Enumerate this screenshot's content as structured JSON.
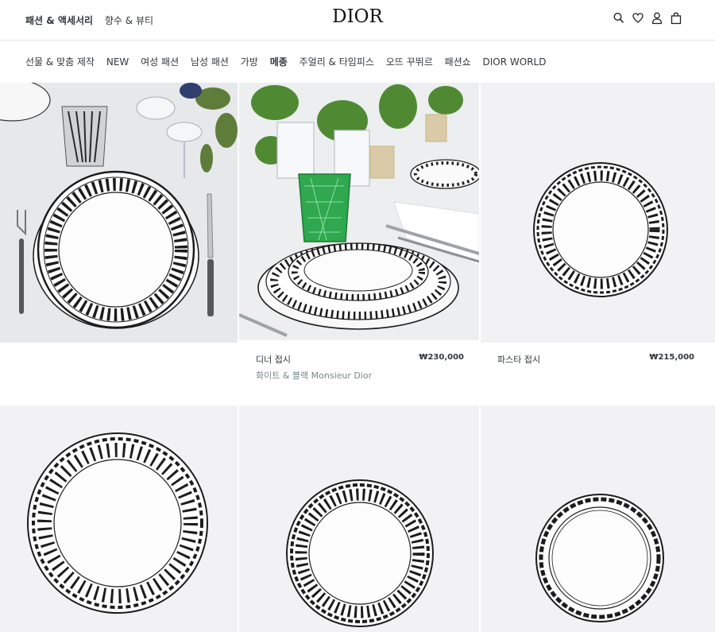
{
  "header": {
    "top_links": [
      {
        "label": "패션 & 액세서리",
        "active": true
      },
      {
        "label": "향수 & 뷰티",
        "active": false
      }
    ],
    "logo": "DIOR",
    "icons": [
      "search-icon",
      "wishlist-heart-icon",
      "account-icon",
      "shopping-bag-icon"
    ]
  },
  "nav": {
    "items": [
      {
        "label": "선물 & 맞춤 제작",
        "active": false
      },
      {
        "label": "NEW",
        "active": false
      },
      {
        "label": "여성 패션",
        "active": false
      },
      {
        "label": "남성 패션",
        "active": false
      },
      {
        "label": "가방",
        "active": false
      },
      {
        "label": "메종",
        "active": true
      },
      {
        "label": "주얼리 & 타임피스",
        "active": false
      },
      {
        "label": "오뜨 꾸뛰르",
        "active": false
      },
      {
        "label": "패션쇼",
        "active": false
      },
      {
        "label": "DIOR WORLD",
        "active": false
      }
    ]
  },
  "products": [
    {
      "name": "디너 접시",
      "subtitle": "화이트 & 블랙 Monsieur Dior",
      "price": "₩230,000"
    },
    {
      "name": "파스타 접시",
      "subtitle": "",
      "price": "₩215,000"
    }
  ],
  "colors": {
    "text": "#33383c",
    "product_bg": "#f2f2f4",
    "plate_black": "#1c1c1c",
    "glass_green": "#2fa84f"
  }
}
